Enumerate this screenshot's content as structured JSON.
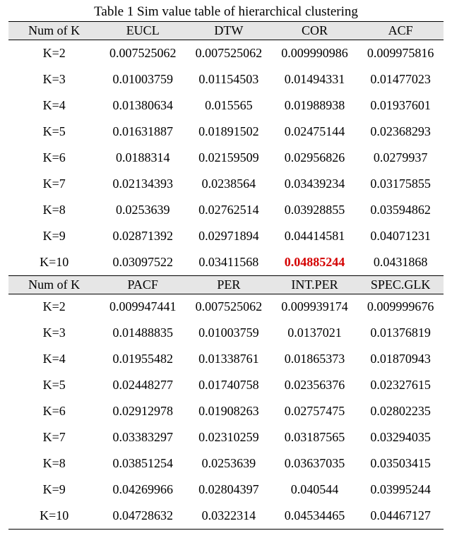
{
  "title": "Table 1 Sim value table of hierarchical clustering",
  "headerK": "Num of K",
  "headers1": [
    "EUCL",
    "DTW",
    "COR",
    "ACF"
  ],
  "headers2": [
    "PACF",
    "PER",
    "INT.PER",
    "SPEC.GLK"
  ],
  "kLabels": [
    "K=2",
    "K=3",
    "K=4",
    "K=5",
    "K=6",
    "K=7",
    "K=8",
    "K=9",
    "K=10"
  ],
  "rows1": [
    [
      "0.007525062",
      "0.007525062",
      "0.009990986",
      "0.009975816"
    ],
    [
      "0.01003759",
      "0.01154503",
      "0.01494331",
      "0.01477023"
    ],
    [
      "0.01380634",
      "0.015565",
      "0.01988938",
      "0.01937601"
    ],
    [
      "0.01631887",
      "0.01891502",
      "0.02475144",
      "0.02368293"
    ],
    [
      "0.0188314",
      "0.02159509",
      "0.02956826",
      "0.0279937"
    ],
    [
      "0.02134393",
      "0.0238564",
      "0.03439234",
      "0.03175855"
    ],
    [
      "0.0253639",
      "0.02762514",
      "0.03928855",
      "0.03594862"
    ],
    [
      "0.02871392",
      "0.02971894",
      "0.04414581",
      "0.04071231"
    ],
    [
      "0.03097522",
      "0.03411568",
      "0.04885244",
      "0.0431868"
    ]
  ],
  "rows2": [
    [
      "0.009947441",
      "0.007525062",
      "0.009939174",
      "0.009999676"
    ],
    [
      "0.01488835",
      "0.01003759",
      "0.0137021",
      "0.01376819"
    ],
    [
      "0.01955482",
      "0.01338761",
      "0.01865373",
      "0.01870943"
    ],
    [
      "0.02448277",
      "0.01740758",
      "0.02356376",
      "0.02327615"
    ],
    [
      "0.02912978",
      "0.01908263",
      "0.02757475",
      "0.02802235"
    ],
    [
      "0.03383297",
      "0.02310259",
      "0.03187565",
      "0.03294035"
    ],
    [
      "0.03851254",
      "0.0253639",
      "0.03637035",
      "0.03503415"
    ],
    [
      "0.04269966",
      "0.02804397",
      "0.040544",
      "0.03995244"
    ],
    [
      "0.04728632",
      "0.0322314",
      "0.04534465",
      "0.04467127"
    ]
  ],
  "highlight": {
    "table": 1,
    "row": 8,
    "col": 2
  }
}
